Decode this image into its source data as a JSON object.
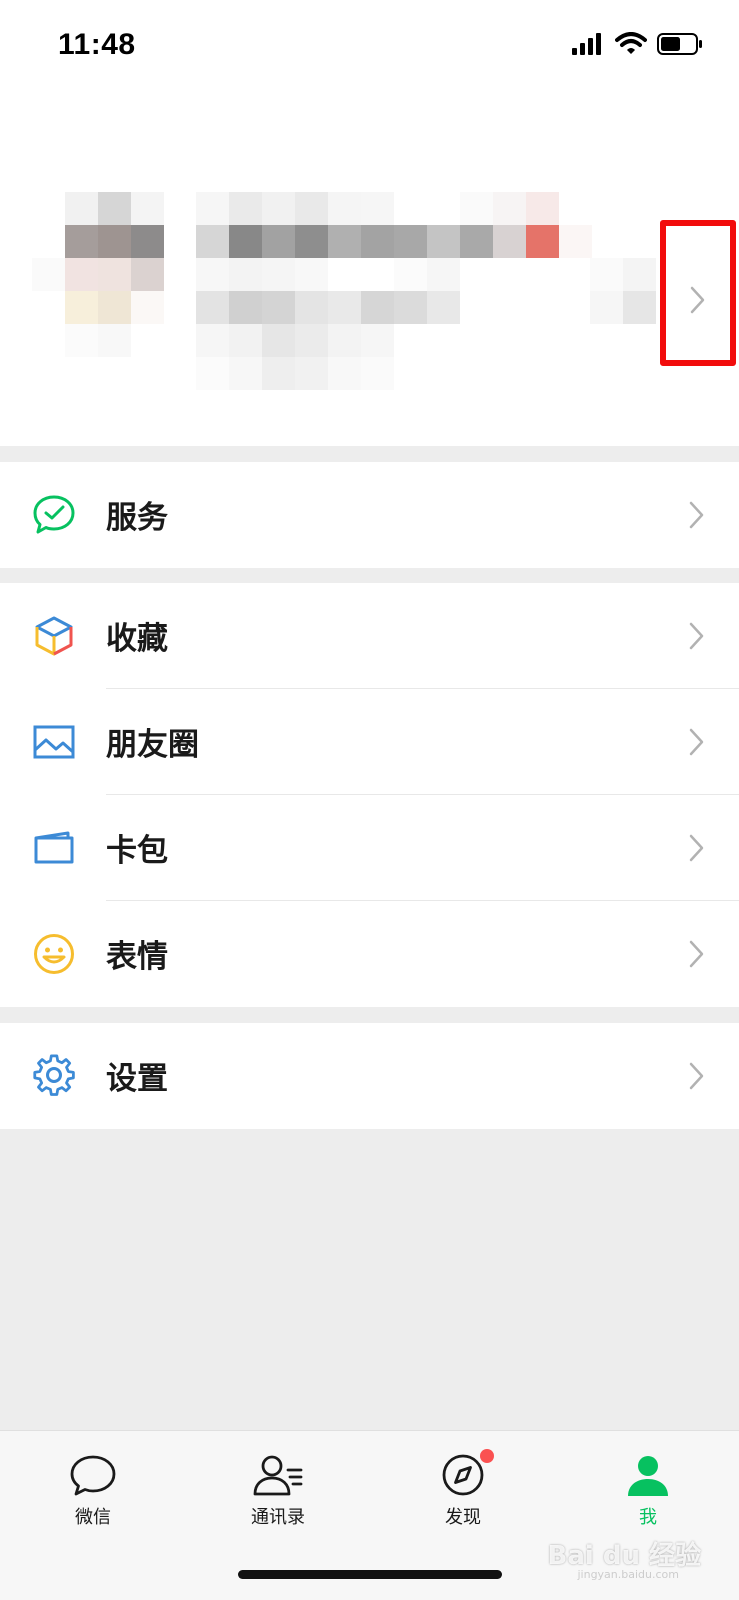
{
  "status_bar": {
    "time": "11:48"
  },
  "menu": {
    "services": {
      "label": "服务"
    },
    "favorites": {
      "label": "收藏"
    },
    "moments": {
      "label": "朋友圈"
    },
    "cards": {
      "label": "卡包"
    },
    "stickers": {
      "label": "表情"
    },
    "settings": {
      "label": "设置"
    }
  },
  "tabs": [
    {
      "label": "微信",
      "icon": "chat-bubble-icon"
    },
    {
      "label": "通讯录",
      "icon": "contacts-icon"
    },
    {
      "label": "发现",
      "icon": "compass-icon"
    },
    {
      "label": "我",
      "icon": "person-icon"
    }
  ],
  "watermark": {
    "text": "Bai du 经验",
    "sub": "jingyan.baidu.com"
  },
  "colors": {
    "accent": "#07c160",
    "badge": "#fa5151",
    "highlight": "#f20c0c",
    "background": "#ededed"
  }
}
